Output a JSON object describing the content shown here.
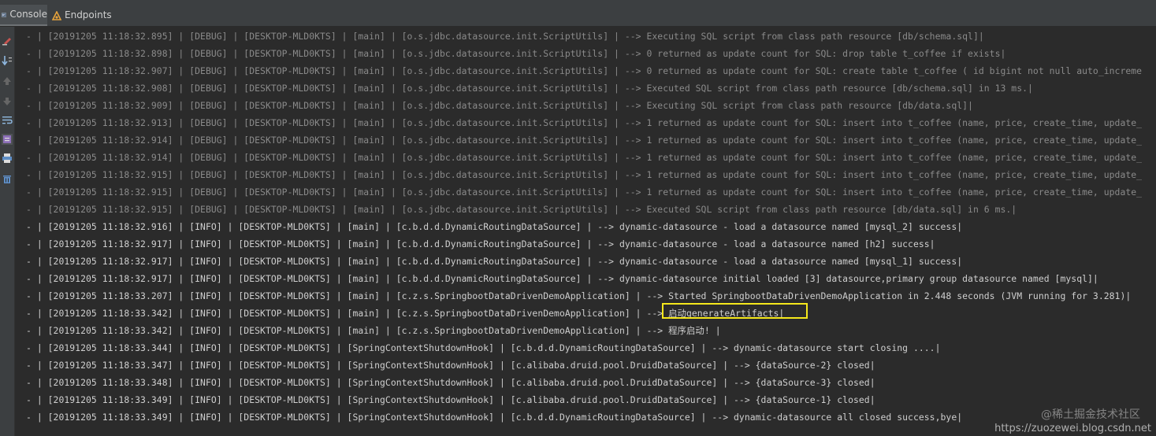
{
  "tabs": [
    {
      "label": "Console",
      "icon": "console-icon"
    },
    {
      "label": "Endpoints",
      "icon": "endpoints-icon"
    }
  ],
  "gutter_icons": [
    "clear-icon",
    "scroll-to-end-icon",
    "up-arrow-icon",
    "down-arrow-icon",
    "soft-wrap-icon",
    "filter-icon",
    "print-icon",
    "trash-icon"
  ],
  "log_lines": [
    {
      "level": "debug",
      "text": "- | [20191205 11:18:32.895] | [DEBUG] | [DESKTOP-MLD0KTS] | [main] | [o.s.jdbc.datasource.init.ScriptUtils] | --> Executing SQL script from class path resource [db/schema.sql]|"
    },
    {
      "level": "debug",
      "text": "- | [20191205 11:18:32.898] | [DEBUG] | [DESKTOP-MLD0KTS] | [main] | [o.s.jdbc.datasource.init.ScriptUtils] | --> 0 returned as update count for SQL: drop table t_coffee if exists|"
    },
    {
      "level": "debug",
      "text": "- | [20191205 11:18:32.907] | [DEBUG] | [DESKTOP-MLD0KTS] | [main] | [o.s.jdbc.datasource.init.ScriptUtils] | --> 0 returned as update count for SQL: create table t_coffee ( id bigint not null auto_increme"
    },
    {
      "level": "debug",
      "text": "- | [20191205 11:18:32.908] | [DEBUG] | [DESKTOP-MLD0KTS] | [main] | [o.s.jdbc.datasource.init.ScriptUtils] | --> Executed SQL script from class path resource [db/schema.sql] in 13 ms.|"
    },
    {
      "level": "debug",
      "text": "- | [20191205 11:18:32.909] | [DEBUG] | [DESKTOP-MLD0KTS] | [main] | [o.s.jdbc.datasource.init.ScriptUtils] | --> Executing SQL script from class path resource [db/data.sql]|"
    },
    {
      "level": "debug",
      "text": "- | [20191205 11:18:32.913] | [DEBUG] | [DESKTOP-MLD0KTS] | [main] | [o.s.jdbc.datasource.init.ScriptUtils] | --> 1 returned as update count for SQL: insert into t_coffee (name, price, create_time, update_"
    },
    {
      "level": "debug",
      "text": "- | [20191205 11:18:32.914] | [DEBUG] | [DESKTOP-MLD0KTS] | [main] | [o.s.jdbc.datasource.init.ScriptUtils] | --> 1 returned as update count for SQL: insert into t_coffee (name, price, create_time, update_"
    },
    {
      "level": "debug",
      "text": "- | [20191205 11:18:32.914] | [DEBUG] | [DESKTOP-MLD0KTS] | [main] | [o.s.jdbc.datasource.init.ScriptUtils] | --> 1 returned as update count for SQL: insert into t_coffee (name, price, create_time, update_"
    },
    {
      "level": "debug",
      "text": "- | [20191205 11:18:32.915] | [DEBUG] | [DESKTOP-MLD0KTS] | [main] | [o.s.jdbc.datasource.init.ScriptUtils] | --> 1 returned as update count for SQL: insert into t_coffee (name, price, create_time, update_"
    },
    {
      "level": "debug",
      "text": "- | [20191205 11:18:32.915] | [DEBUG] | [DESKTOP-MLD0KTS] | [main] | [o.s.jdbc.datasource.init.ScriptUtils] | --> 1 returned as update count for SQL: insert into t_coffee (name, price, create_time, update_"
    },
    {
      "level": "debug",
      "text": "- | [20191205 11:18:32.915] | [DEBUG] | [DESKTOP-MLD0KTS] | [main] | [o.s.jdbc.datasource.init.ScriptUtils] | --> Executed SQL script from class path resource [db/data.sql] in 6 ms.|"
    },
    {
      "level": "info",
      "text": "- | [20191205 11:18:32.916] | [INFO] | [DESKTOP-MLD0KTS] | [main] | [c.b.d.d.DynamicRoutingDataSource] | --> dynamic-datasource - load a datasource named [mysql_2] success|"
    },
    {
      "level": "info",
      "text": "- | [20191205 11:18:32.917] | [INFO] | [DESKTOP-MLD0KTS] | [main] | [c.b.d.d.DynamicRoutingDataSource] | --> dynamic-datasource - load a datasource named [h2] success|"
    },
    {
      "level": "info",
      "text": "- | [20191205 11:18:32.917] | [INFO] | [DESKTOP-MLD0KTS] | [main] | [c.b.d.d.DynamicRoutingDataSource] | --> dynamic-datasource - load a datasource named [mysql_1] success|"
    },
    {
      "level": "info",
      "text": "- | [20191205 11:18:32.917] | [INFO] | [DESKTOP-MLD0KTS] | [main] | [c.b.d.d.DynamicRoutingDataSource] | --> dynamic-datasource initial loaded [3] datasource,primary group datasource named [mysql]|"
    },
    {
      "level": "info",
      "text": "- | [20191205 11:18:33.207] | [INFO] | [DESKTOP-MLD0KTS] | [main] | [c.z.s.SpringbootDataDrivenDemoApplication] | --> Started SpringbootDataDrivenDemoApplication in 2.448 seconds (JVM running for 3.281)|"
    },
    {
      "level": "info",
      "text": "- | [20191205 11:18:33.342] | [INFO] | [DESKTOP-MLD0KTS] | [main] | [c.z.s.SpringbootDataDrivenDemoApplication] | --> 启动generateArtifacts|"
    },
    {
      "level": "info",
      "text": "- | [20191205 11:18:33.342] | [INFO] | [DESKTOP-MLD0KTS] | [main] | [c.z.s.SpringbootDataDrivenDemoApplication] | --> 程序启动! |"
    },
    {
      "level": "info",
      "text": "- | [20191205 11:18:33.344] | [INFO] | [DESKTOP-MLD0KTS] | [SpringContextShutdownHook] | [c.b.d.d.DynamicRoutingDataSource] | --> dynamic-datasource start closing ....|"
    },
    {
      "level": "info",
      "text": "- | [20191205 11:18:33.347] | [INFO] | [DESKTOP-MLD0KTS] | [SpringContextShutdownHook] | [c.alibaba.druid.pool.DruidDataSource] | --> {dataSource-2} closed|"
    },
    {
      "level": "info",
      "text": "- | [20191205 11:18:33.348] | [INFO] | [DESKTOP-MLD0KTS] | [SpringContextShutdownHook] | [c.alibaba.druid.pool.DruidDataSource] | --> {dataSource-3} closed|"
    },
    {
      "level": "info",
      "text": "- | [20191205 11:18:33.349] | [INFO] | [DESKTOP-MLD0KTS] | [SpringContextShutdownHook] | [c.alibaba.druid.pool.DruidDataSource] | --> {dataSource-1} closed|"
    },
    {
      "level": "info",
      "text": "- | [20191205 11:18:33.349] | [INFO] | [DESKTOP-MLD0KTS] | [SpringContextShutdownHook] | [c.b.d.d.DynamicRoutingDataSource] | --> dynamic-datasource all closed success,bye|"
    }
  ],
  "watermark": "@稀土掘金技术社区",
  "watermark_url": "https://zuozewei.blog.csdn.net",
  "colors": {
    "highlight_box": "#f5e81c",
    "debug_text": "#8a8a8a",
    "info_text": "#cfcfcf",
    "background": "#2b2b2b"
  }
}
